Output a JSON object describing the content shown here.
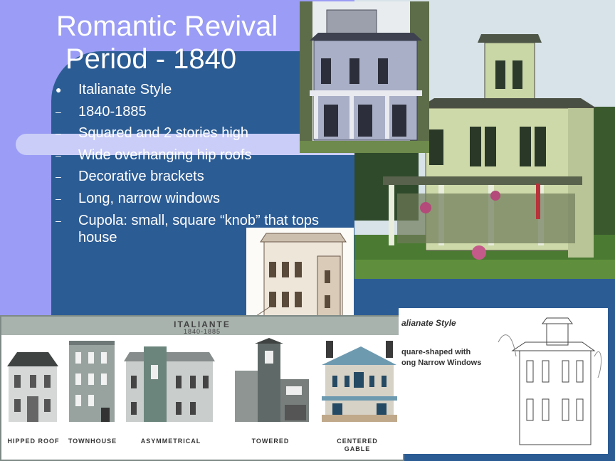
{
  "slide": {
    "title_line1": "Romantic Revival",
    "title_line2": "Period - 1840",
    "bullets": [
      {
        "marker": "●",
        "text": "Italianate Style"
      },
      {
        "marker": "–",
        "text": "1840-1885"
      },
      {
        "marker": "–",
        "text": "Squared and 2 stories high"
      },
      {
        "marker": "–",
        "text": "Wide overhanging hip roofs"
      },
      {
        "marker": "–",
        "text": "Decorative brackets"
      },
      {
        "marker": "–",
        "text": "Long, narrow windows"
      },
      {
        "marker": "–",
        "text": "Cupola: small, square “knob” that tops house"
      }
    ]
  },
  "strip": {
    "title": "ITALIANTE",
    "years": "1840-1885",
    "labels": [
      "HIPPED ROOF",
      "TOWNHOUSE",
      "ASYMMETRICAL",
      "TOWERED",
      "CENTERED GABLE"
    ]
  },
  "card": {
    "title": "alianate Style",
    "text": "quare-shaped with ong Narrow Windows"
  },
  "colors": {
    "lavender": "#9a9cf5",
    "slide_blue": "#2c5c94",
    "text": "#ffffff"
  }
}
